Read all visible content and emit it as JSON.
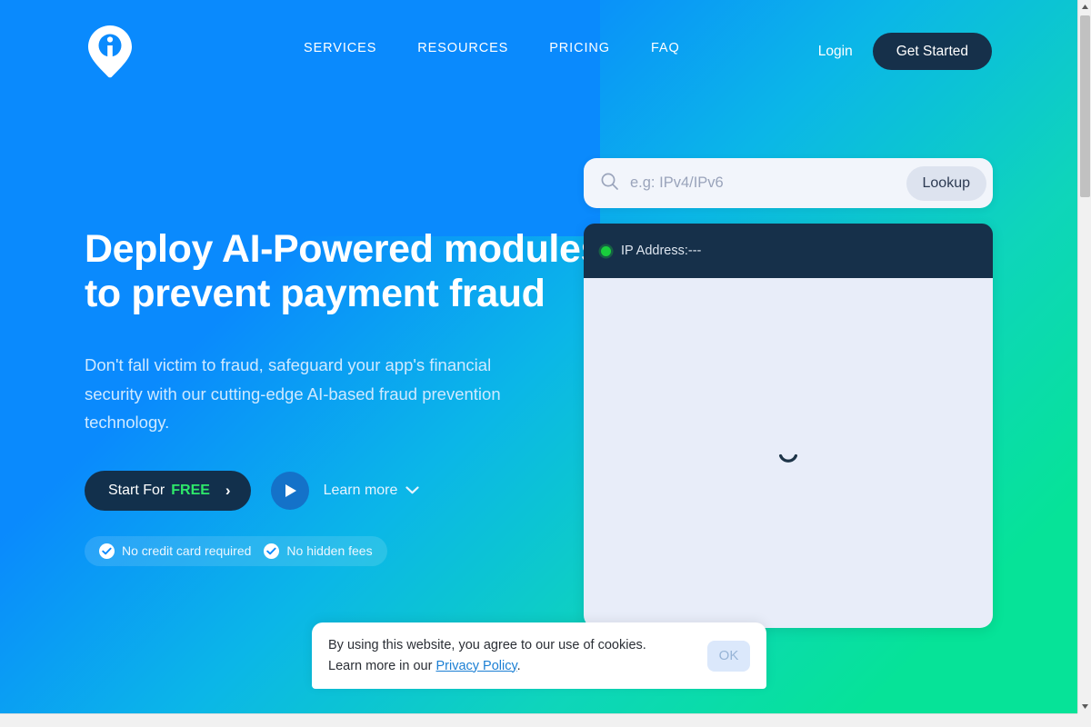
{
  "brand": {
    "logo_icon": "location-pin-i-logo",
    "accent_blue": "#0a8afd",
    "accent_green": "#06e398",
    "dark_navy": "#16304a"
  },
  "header": {
    "nav_items": [
      {
        "label": "SERVICES"
      },
      {
        "label": "RESOURCES"
      },
      {
        "label": "PRICING"
      },
      {
        "label": "FAQ"
      }
    ],
    "login_label": "Login",
    "get_started_label": "Get Started"
  },
  "hero": {
    "title_line1": "Deploy AI-Powered modules",
    "title_line2": "to prevent payment fraud",
    "subtitle": "Don't fall victim to fraud, safeguard your app's financial security with our cutting-edge AI-based fraud prevention technology.",
    "cta_primary_prefix": "Start For",
    "cta_primary_highlight": "FREE",
    "cta_primary_chevron": "›",
    "play_icon": "play-icon",
    "learn_more_label": "Learn more",
    "learn_more_chevron": "chevron-down-icon",
    "badges": [
      {
        "icon": "check-circle-icon",
        "label": "No credit card required"
      },
      {
        "icon": "check-circle-icon",
        "label": "No hidden fees"
      }
    ]
  },
  "lookup": {
    "search_icon": "search-icon",
    "placeholder": "e.g: IPv4/IPv6",
    "value": "",
    "button_label": "Lookup",
    "result": {
      "status_icon": "status-dot-green",
      "ip_label": "IP Address:---",
      "loading_icon": "spinner-icon"
    }
  },
  "cookie_banner": {
    "text_line1": "By using this website, you agree to our use of cookies.",
    "text_line2_prefix": "Learn more in our ",
    "link_label": "Privacy Policy",
    "text_line2_suffix": ".",
    "ok_label": "OK"
  },
  "scrollbar": {
    "up_arrow": "▲",
    "down_arrow": "▼"
  }
}
